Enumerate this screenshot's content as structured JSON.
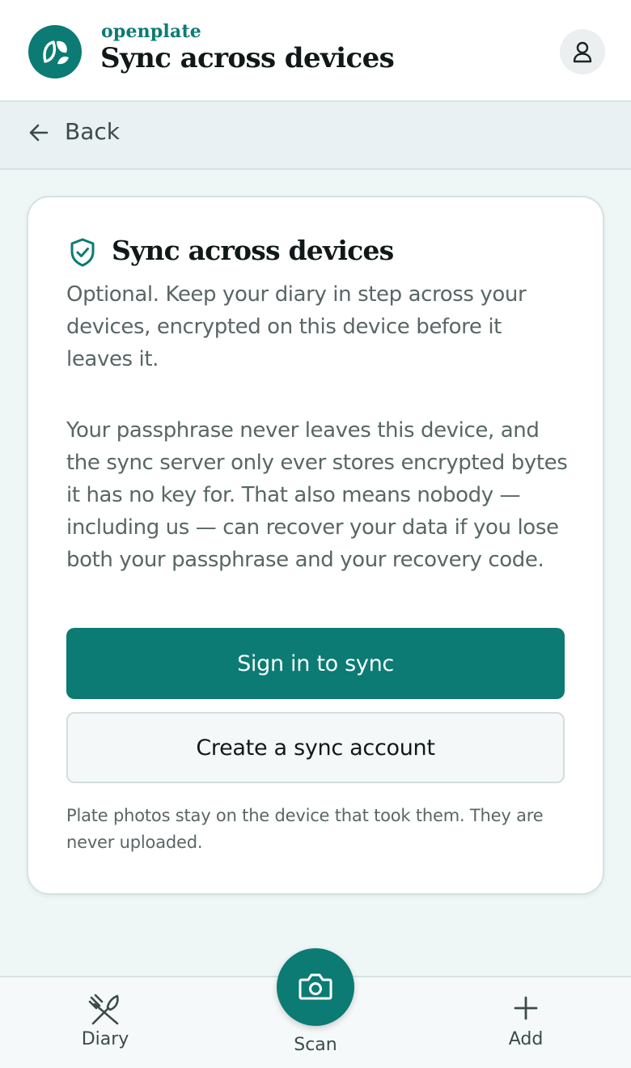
{
  "header": {
    "brand": "openplate",
    "title": "Sync across devices"
  },
  "back": {
    "label": "Back"
  },
  "card": {
    "title": "Sync across devices",
    "intro": "Optional. Keep your diary in step across your devices, encrypted on this device before it leaves it.",
    "detail": "Your passphrase never leaves this device, and the sync server only ever stores encrypted bytes it has no key for. That also means nobody — including us — can recover your data if you lose both your passphrase and your recovery code.",
    "primary_button": "Sign in to sync",
    "secondary_button": "Create a sync account",
    "note": "Plate photos stay on the device that took them. They are never uploaded."
  },
  "nav": {
    "diary": "Diary",
    "scan": "Scan",
    "add": "Add"
  },
  "icons": {
    "logo": "leaf-logo-icon",
    "profile": "user-icon",
    "back": "arrow-left-icon",
    "shield": "shield-check-icon",
    "diary": "fork-knife-icon",
    "scan": "camera-icon",
    "add": "plus-icon"
  },
  "colors": {
    "brand": "#0b7b74",
    "background": "#eff6f6",
    "text_primary": "#111818",
    "text_secondary": "#5a6666"
  }
}
